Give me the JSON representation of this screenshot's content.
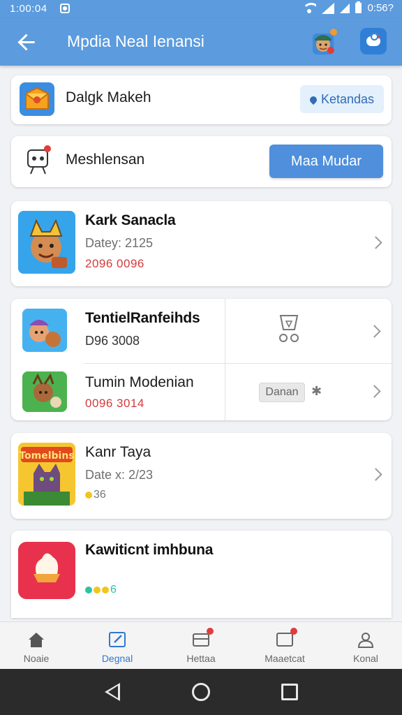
{
  "status_bar": {
    "time": "1:00:04",
    "right_text": "0:56?"
  },
  "app_bar": {
    "title": "Mpdia Neal Ienansi"
  },
  "top_card": {
    "label": "Dalgk Makeh",
    "button": "Ketandas"
  },
  "second_card": {
    "label": "Meshlensan",
    "button": "Maa Mudar"
  },
  "items": [
    {
      "title": "Kark Sanacla",
      "date": "Datey: 2125",
      "meta": "2096 0096"
    },
    {
      "title": "TentielRanfeihds",
      "meta": "D96 3008"
    },
    {
      "title": "Tumin Modenian",
      "meta": "0096 3014",
      "chip": "Danan"
    },
    {
      "title": "Kanr Taya",
      "date": "Date x: 2/23",
      "meta": "36"
    },
    {
      "title": "Kawiticnt imhbuna",
      "meta": "6"
    }
  ],
  "thumb_text": {
    "fourth": "Tomelbins"
  },
  "bottom_nav": [
    {
      "label": "Noaie",
      "icon": "home-icon"
    },
    {
      "label": "Degnal",
      "icon": "edit-icon",
      "active": true
    },
    {
      "label": "Hettaa",
      "icon": "tray-icon"
    },
    {
      "label": "Maaetcat",
      "icon": "message-icon"
    },
    {
      "label": "Konal",
      "icon": "user-icon"
    }
  ],
  "colors": {
    "primary": "#5b9bde",
    "accent": "#4f8fdc",
    "red": "#d23b3b"
  }
}
